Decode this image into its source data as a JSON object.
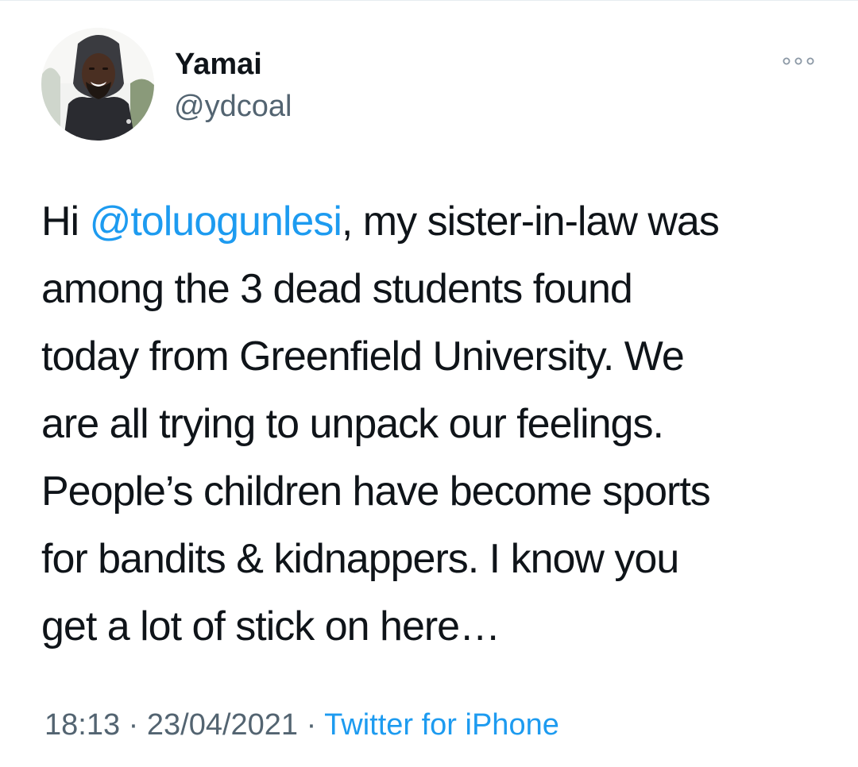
{
  "author": {
    "display_name": "Yamai",
    "handle": "@ydcoal"
  },
  "more_icon": "more-horizontal-icon",
  "tweet": {
    "lines": [
      {
        "pre": "Hi ",
        "mention": "@toluogunlesi",
        "post": ", my sister-in-law was"
      },
      {
        "text": "among the 3 dead students  found"
      },
      {
        "text": "today from Greenfield University. We"
      },
      {
        "text": "are all trying to unpack our feelings."
      },
      {
        "text": "People’s children have become sports"
      },
      {
        "text": "for bandits & kidnappers. I know you"
      },
      {
        "text": "get a lot of stick on here…"
      }
    ]
  },
  "meta": {
    "time": "18:13",
    "separator": " · ",
    "date": "23/04/2021",
    "source": "Twitter for iPhone"
  },
  "colors": {
    "link": "#1d9bf0",
    "secondary_text": "#536471",
    "primary_text": "#0f1419"
  }
}
